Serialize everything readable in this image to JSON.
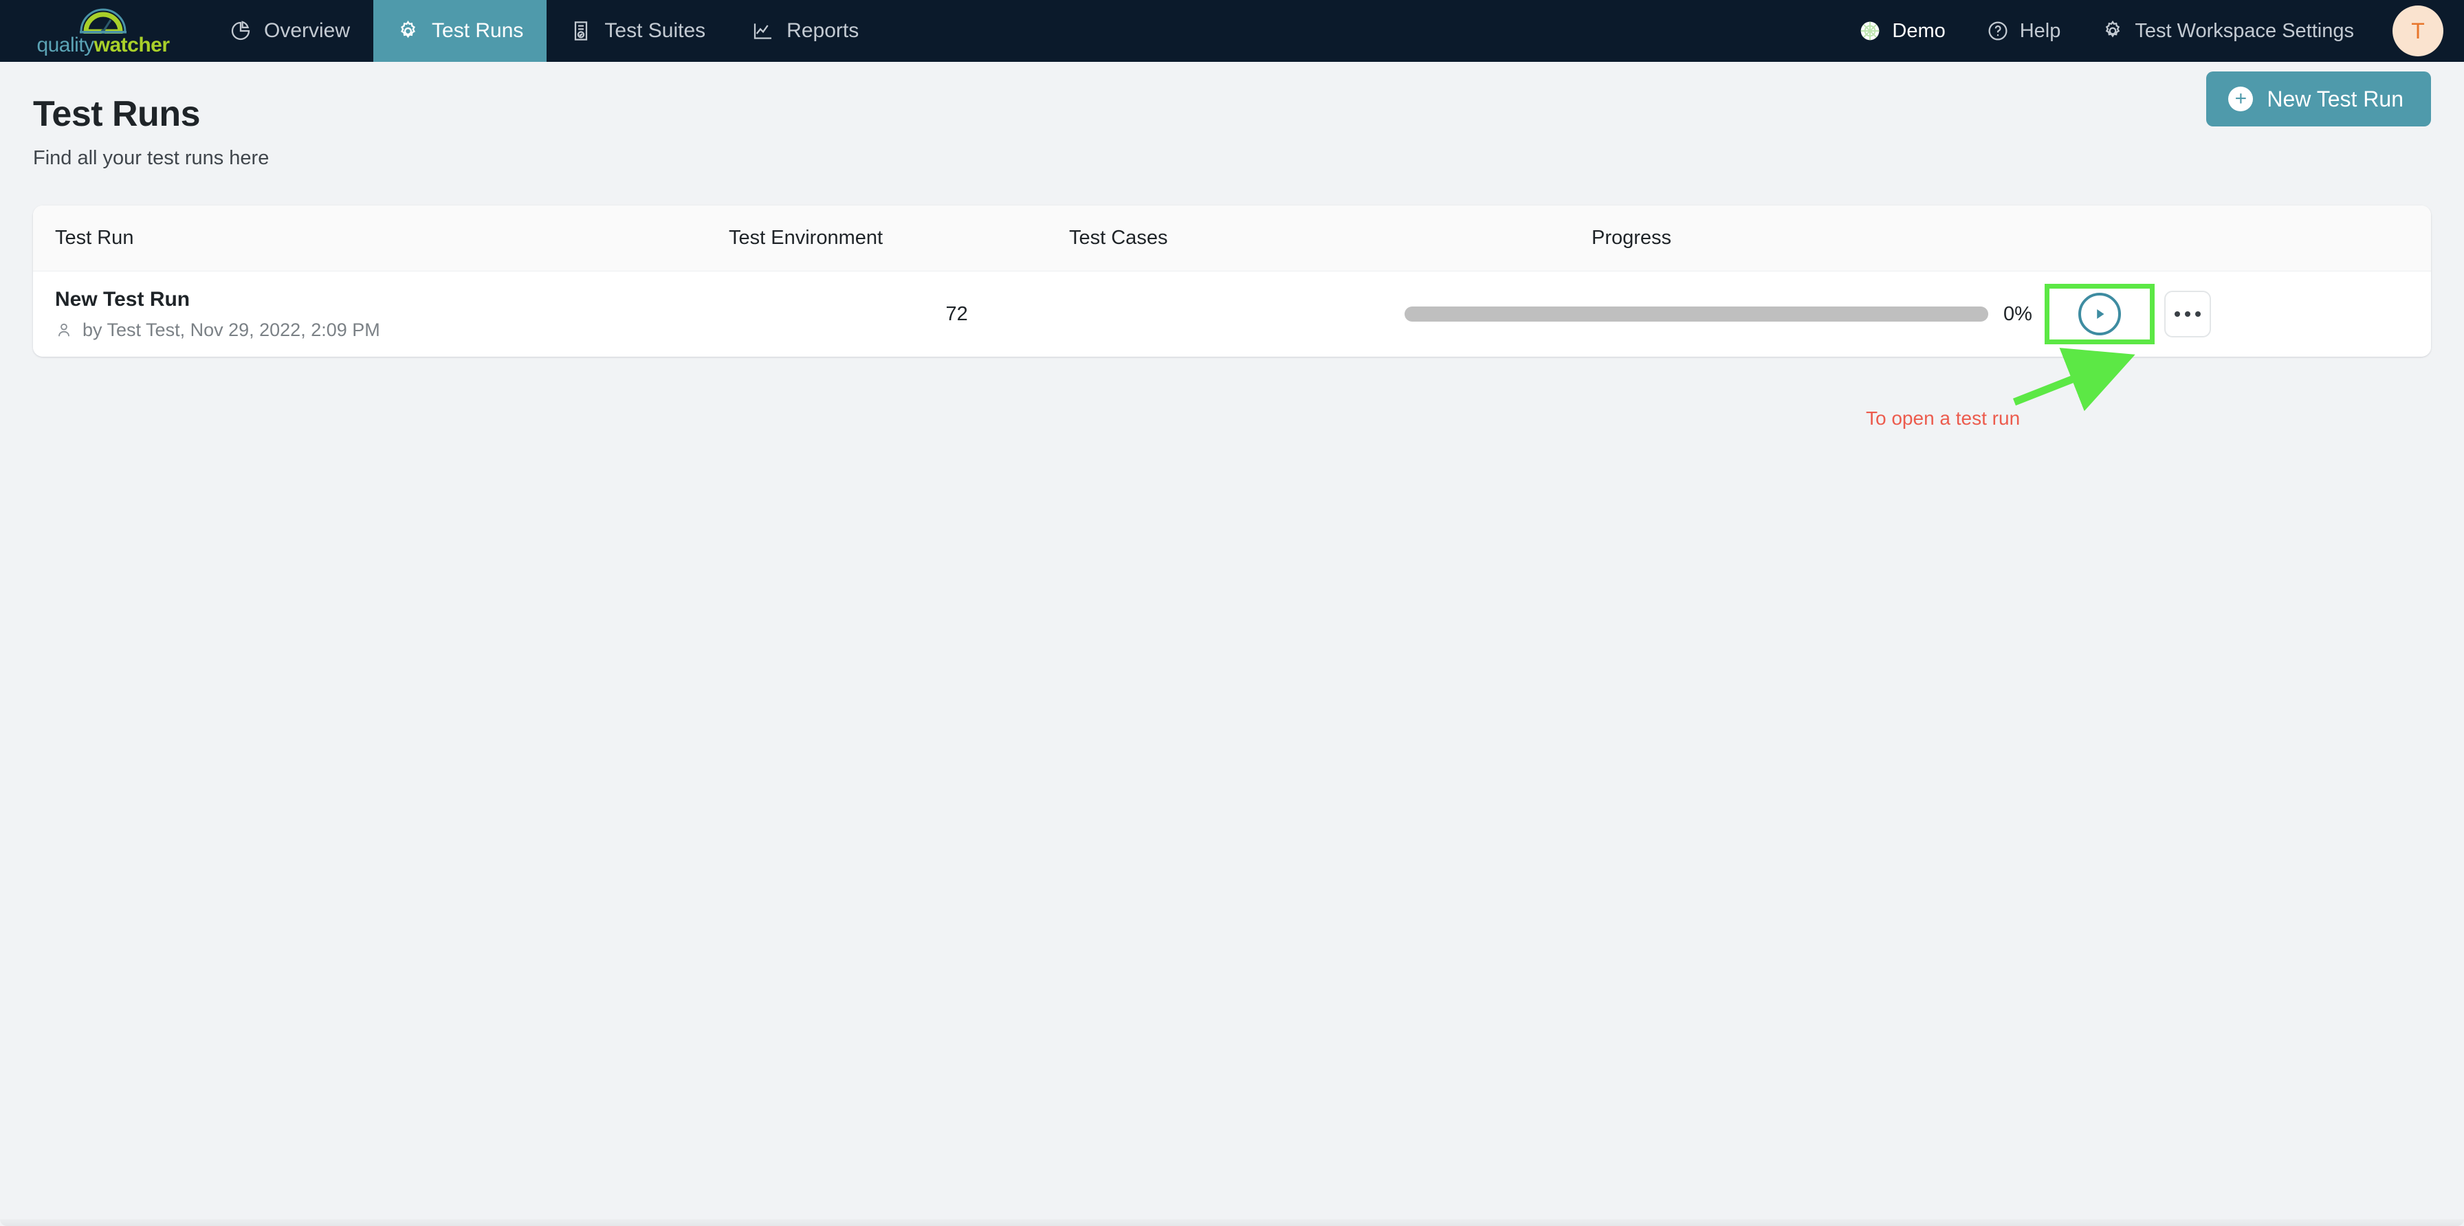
{
  "brand": {
    "name_part1": "quality",
    "name_part2": "watcher",
    "logo_icon": "gauge-gear-icon"
  },
  "navbar": {
    "tabs": [
      {
        "label": "Overview",
        "icon": "pie-chart-icon",
        "active": false
      },
      {
        "label": "Test Runs",
        "icon": "gear-icon",
        "active": true
      },
      {
        "label": "Test Suites",
        "icon": "document-check-icon",
        "active": false
      },
      {
        "label": "Reports",
        "icon": "line-chart-icon",
        "active": false
      }
    ],
    "right_items": [
      {
        "label": "Demo",
        "icon": "globe-icon"
      },
      {
        "label": "Help",
        "icon": "question-circle-icon"
      },
      {
        "label": "Test Workspace Settings",
        "icon": "gear-icon"
      }
    ],
    "avatar_initial": "T",
    "avatar_bg": "#fae3cf",
    "avatar_fg": "#e8762b",
    "bg_color": "#0b1a2b",
    "active_tab_color": "#4f9aab"
  },
  "page": {
    "title": "Test Runs",
    "subtitle": "Find all your test runs here",
    "new_run_button": "New Test Run",
    "new_run_icon": "plus-circle-icon",
    "accent_color": "#4f9aab"
  },
  "table": {
    "columns": [
      "Test Run",
      "Test Environment",
      "Test Cases",
      "Progress"
    ],
    "rows": [
      {
        "name": "New Test Run",
        "meta_icon": "user-icon",
        "meta": "by Test Test, Nov 29, 2022, 2:09 PM",
        "environment": "",
        "test_cases": "72",
        "progress_percent": 0,
        "progress_label": "0%",
        "play_icon": "play-circle-icon",
        "more_icon": "ellipsis-icon"
      }
    ]
  },
  "annotation": {
    "text": "To open a test run",
    "text_color": "#ec5b4d",
    "arrow_color": "#5ce845",
    "highlight_color": "#5ce845"
  }
}
